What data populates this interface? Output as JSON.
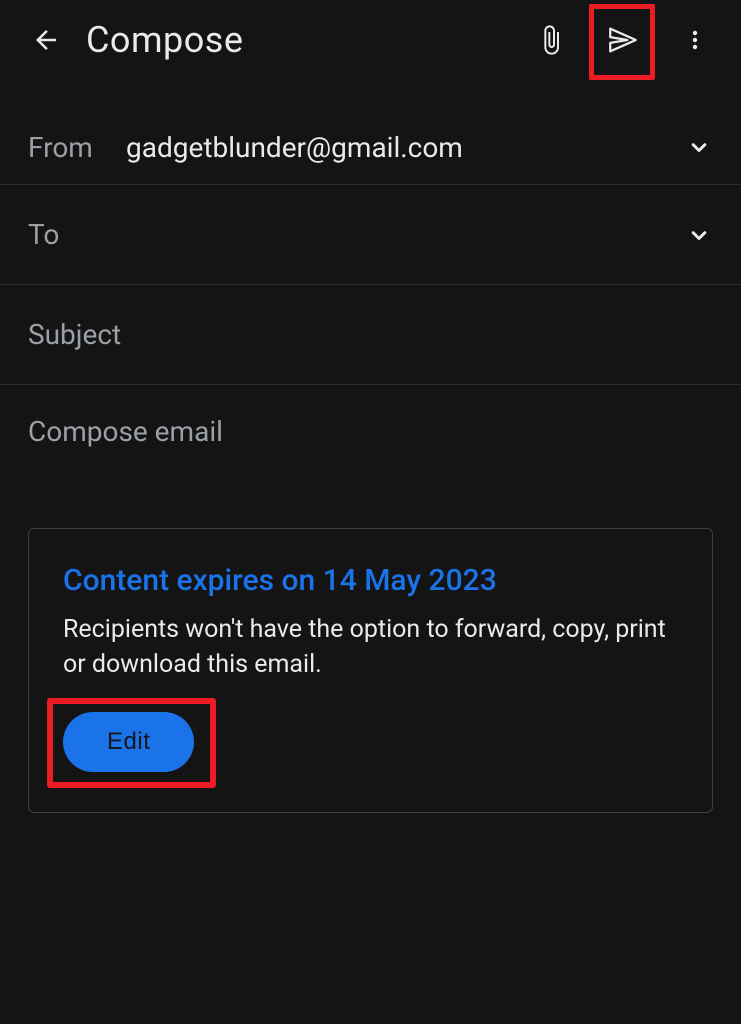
{
  "header": {
    "title": "Compose"
  },
  "from": {
    "label": "From",
    "value": "gadgetblunder@gmail.com"
  },
  "to": {
    "label": "To",
    "value": ""
  },
  "subject": {
    "placeholder": "Subject",
    "value": ""
  },
  "body": {
    "placeholder": "Compose email",
    "value": ""
  },
  "confidential": {
    "title": "Content expires on 14 May 2023",
    "description": "Recipients won't have the option to forward, copy, print or download this email.",
    "edit_label": "Edit"
  }
}
